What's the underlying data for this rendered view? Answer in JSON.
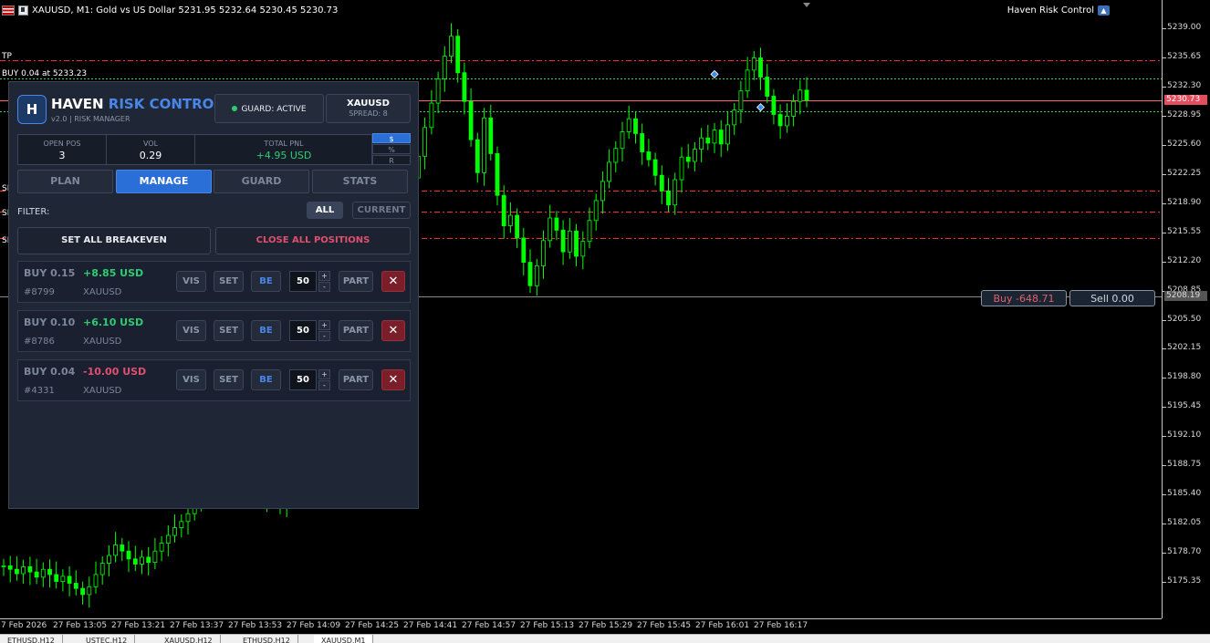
{
  "chart": {
    "header": "XAUUSD, M1:  Gold vs US Dollar  5231.95 5232.64 5230.45 5230.73",
    "ea_label": "Haven Risk Control",
    "line_labels": {
      "tp": "TP",
      "buy": "BUY 0.04 at 5233.23",
      "sl1": "SL",
      "sl2": "SL",
      "sl3": "SL"
    },
    "bid_tag": "5230.73",
    "crosshair_tag": "5208.19",
    "buy_button": "Buy -648.71",
    "sell_button": "Sell 0.00",
    "price_ticks": [
      "5239.00",
      "5235.65",
      "5232.30",
      "5228.95",
      "5225.60",
      "5222.25",
      "5218.90",
      "5215.55",
      "5212.20",
      "5208.85",
      "5205.50",
      "5202.15",
      "5198.80",
      "5195.45",
      "5192.10",
      "5188.75",
      "5185.40",
      "5182.05",
      "5178.70",
      "5175.35"
    ],
    "time_ticks": [
      "7 Feb 2026",
      "27 Feb 13:05",
      "27 Feb 13:21",
      "27 Feb 13:37",
      "27 Feb 13:53",
      "27 Feb 14:09",
      "27 Feb 14:25",
      "27 Feb 14:41",
      "27 Feb 14:57",
      "27 Feb 15:13",
      "27 Feb 15:29",
      "27 Feb 15:45",
      "27 Feb 16:01",
      "27 Feb 16:17"
    ],
    "tabs": [
      "ETHUSD,H12",
      "USTEC,H12",
      "XAUUSD,H12",
      "ETHUSD,H12",
      "XAUUSD,M1"
    ],
    "colors": {
      "candle": "#00ff00",
      "sl_line": "#ff3030",
      "tp_line": "#ff3030",
      "entry_line": "#39d353",
      "bid_line": "#ff6070"
    }
  },
  "chart_data": {
    "type": "candlestick",
    "series": [
      {
        "name": "XAUUSD M1",
        "close": [
          5177.2,
          5176.8,
          5176.3,
          5177.1,
          5176.5,
          5175.9,
          5176.8,
          5176.2,
          5175.4,
          5176.0,
          5175.2,
          5174.6,
          5173.9,
          5174.8,
          5176.2,
          5177.5,
          5178.4,
          5179.6,
          5178.9,
          5178.0,
          5177.4,
          5178.2,
          5177.6,
          5178.9,
          5179.8,
          5180.7,
          5181.6,
          5182.3,
          5183.2,
          5184.6,
          5185.5,
          5186.3,
          5187.1,
          5187.9,
          5188.4,
          5187.6,
          5186.8,
          5186.2,
          5185.3,
          5185.8,
          5184.9,
          5185.6,
          5184.3,
          5184.9,
          5185.7,
          5186.5,
          5187.4,
          5188.6,
          5190.1,
          5191.6,
          5193.0,
          5194.5,
          5195.8,
          5198.9,
          5204.2,
          5209.8,
          5214.2,
          5213.1,
          5214.0,
          5215.6,
          5216.4,
          5219.1,
          5221.8,
          5224.3,
          5227.6,
          5230.4,
          5233.2,
          5235.8,
          5238.1,
          5233.9,
          5230.6,
          5226.2,
          5222.4,
          5228.7,
          5224.6,
          5219.8,
          5216.3,
          5217.5,
          5214.9,
          5212.1,
          5209.4,
          5211.7,
          5214.6,
          5217.2,
          5215.8,
          5213.3,
          5215.7,
          5212.8,
          5214.5,
          5216.9,
          5219.2,
          5221.4,
          5223.6,
          5225.2,
          5227.1,
          5228.6,
          5226.9,
          5224.8,
          5223.9,
          5222.1,
          5220.3,
          5218.7,
          5221.6,
          5224.2,
          5223.7,
          5225.1,
          5226.4,
          5225.8,
          5227.3,
          5225.7,
          5227.9,
          5229.6,
          5231.8,
          5234.2,
          5235.6,
          5233.4,
          5231.2,
          5229.1,
          5227.8,
          5228.9,
          5230.6,
          5231.9,
          5230.73
        ]
      }
    ],
    "ylim": [
      5172.0,
      5241.0
    ],
    "levels": {
      "tp": 5235.3,
      "buy_entry": 5233.23,
      "bid": 5230.73,
      "entry_upper": 5232.5,
      "entry_lower": 5229.5,
      "sl1": 5220.3,
      "sl2": 5217.9,
      "sl3": 5214.9,
      "crosshair": 5208.19
    }
  },
  "panel": {
    "logo": "H",
    "brand_main": "HAVEN",
    "brand_accent": "RISK CONTROL",
    "subtitle": "v2.0 | RISK MANAGER",
    "guard": "GUARD: ACTIVE",
    "symbol": "XAUUSD",
    "spread": "SPREAD: 8",
    "stats": {
      "open_pos_label": "OPEN POS",
      "open_pos": "3",
      "vol_label": "VOL",
      "vol": "0.29",
      "pnl_label": "TOTAL PNL",
      "pnl": "+4.95 USD"
    },
    "units": [
      "$",
      "%",
      "R"
    ],
    "tabs": {
      "plan": "PLAN",
      "manage": "MANAGE",
      "guard": "GUARD",
      "stats": "STATS"
    },
    "filter_label": "FILTER:",
    "filter_all": "ALL",
    "filter_current": "CURRENT",
    "set_all_breakeven": "SET ALL BREAKEVEN",
    "close_all": "CLOSE ALL POSITIONS",
    "buttons": {
      "vis": "VIS",
      "set": "SET",
      "be": "BE",
      "part": "PART",
      "close": "✕",
      "plus": "+",
      "minus": "-"
    },
    "positions": [
      {
        "side": "BUY 0.15",
        "pnl": "+8.85  USD",
        "ticket": "#8799",
        "symbol": "XAUUSD",
        "pct": "50",
        "pnl_color": "#2ecc71"
      },
      {
        "side": "BUY 0.10",
        "pnl": "+6.10  USD",
        "ticket": "#8786",
        "symbol": "XAUUSD",
        "pct": "50",
        "pnl_color": "#2ecc71"
      },
      {
        "side": "BUY 0.04",
        "pnl": "-10.00  USD",
        "ticket": "#4331",
        "symbol": "XAUUSD",
        "pct": "50",
        "pnl_color": "#e0506e"
      }
    ]
  }
}
